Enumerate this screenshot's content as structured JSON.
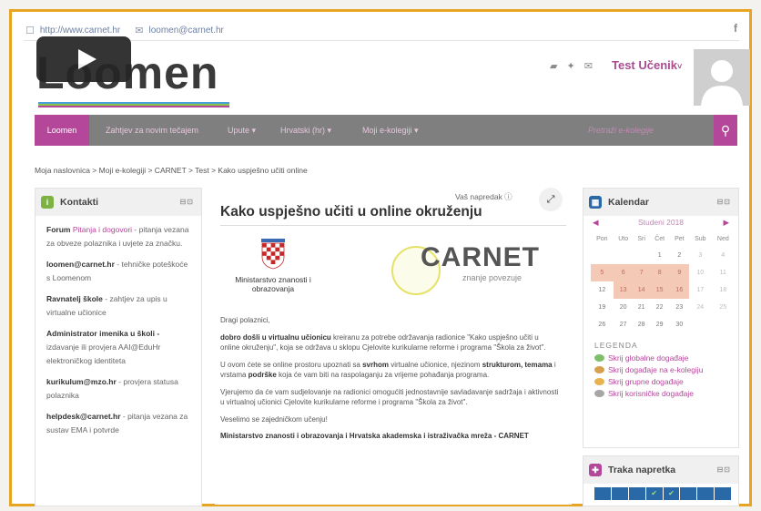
{
  "top_bar": {
    "url": "http://www.carnet.hr",
    "email": "loomen@carnet.hr",
    "facebook_icon": "f"
  },
  "logo": {
    "text": "Loomen"
  },
  "user": {
    "name": "Test Učenik",
    "caret": "˅"
  },
  "nav": {
    "items": [
      "Loomen",
      "Zahtjev za novim tečajem",
      "Upute ▾",
      "Hrvatski (hr) ▾",
      "Moji e-kolegiji ▾"
    ],
    "search_placeholder": "Pretraži e-kolegije"
  },
  "breadcrumb": "Moja naslovnica > Moji e-kolegiji > CARNET > Test > Kako uspješno učiti online",
  "contacts": {
    "title": "Kontakti",
    "entries": [
      {
        "label": "Forum",
        "link": "Pitanja i dogovori",
        "desc": "- pitanja vezana za obveze polaznika i uvjete za značku."
      },
      {
        "label": "loomen@carnet.hr",
        "link": "",
        "desc": "- tehničke poteškoće s Loomenom"
      },
      {
        "label": "Ravnatelj škole",
        "link": "",
        "desc": "- zahtjev za upis u virtualne učionice"
      },
      {
        "label": "Administrator imenika u školi -",
        "link": "",
        "desc": "izdavanje ili provjera AAI@EduHr elektroničkog identiteta"
      },
      {
        "label": "kurikulum@mzo.hr",
        "link": "",
        "desc": "- provjera statusa polaznika"
      },
      {
        "label": "helpdesk@carnet.hr",
        "link": "",
        "desc": "- pitanja vezana za sustav EMA i potvrde"
      }
    ]
  },
  "main": {
    "progress_label": "Vaš napredak ⓘ",
    "title": "Kako uspješno učiti u online okruženju",
    "ministry": "Ministarstvo znanosti i obrazovanja",
    "carnet": "CARNET",
    "carnet_sub": "znanje povezuje",
    "greeting": "Dragi polaznici,",
    "p1_bold": "dobro došli u virtualnu učionicu",
    "p1_rest": " kreiranu za potrebe održavanja radionice \"Kako uspješno učiti u online okruženju\", koja se održava u sklopu Cjelovite kurikularne reforme i programa \"Škola za život\".",
    "p2_a": "U ovom ćete se online prostoru upoznati sa ",
    "p2_b1": "svrhom",
    "p2_c": " virtualne učionice, njezinom ",
    "p2_b2": "strukturom, temama",
    "p2_d": " i vrstama ",
    "p2_b3": "podrške",
    "p2_e": " koja će vam biti na raspolaganju za vrijeme pohađanja programa.",
    "p3": "Vjerujemo da će vam sudjelovanje na radionici omogućiti jednostavnije savladavanje sadržaja i aktivnosti u virtualnoj učionici Cjelovite kurikularne reforme i programa \"Škola za život\".",
    "p4": "Veselimo se zajedničkom učenju!",
    "signature": "Ministarstvo znanosti i obrazovanja i Hrvatska akademska i istraživačka mreža - CARNET"
  },
  "calendar": {
    "title": "Kalendar",
    "month": "Studeni 2018",
    "weekdays": [
      "Pon",
      "Uto",
      "Sri",
      "Čet",
      "Pet",
      "Sub",
      "Ned"
    ],
    "weeks": [
      [
        "",
        "",
        "",
        "1",
        "2",
        "3",
        "4"
      ],
      [
        "5",
        "6",
        "7",
        "8",
        "9",
        "10",
        "11"
      ],
      [
        "12",
        "13",
        "14",
        "15",
        "16",
        "17",
        "18"
      ],
      [
        "19",
        "20",
        "21",
        "22",
        "23",
        "24",
        "25"
      ],
      [
        "26",
        "27",
        "28",
        "29",
        "30",
        "",
        ""
      ]
    ],
    "legend_title": "LEGENDA",
    "legend": [
      "Skrij globalne događaje",
      "Skrij događaje na e-kolegiju",
      "Skrij grupne događaje",
      "Skrij korisničke događaje"
    ],
    "legend_colors": [
      "#7fbf6a",
      "#d6a04c",
      "#e8b24f",
      "#a6a6a6"
    ]
  },
  "progress_panel": {
    "title": "Traka napretka"
  },
  "colors": {
    "accent": "#b5479a",
    "frame": "#e8a423",
    "navbar": "#7f7f7f",
    "highlight": "#f4c9b6"
  }
}
